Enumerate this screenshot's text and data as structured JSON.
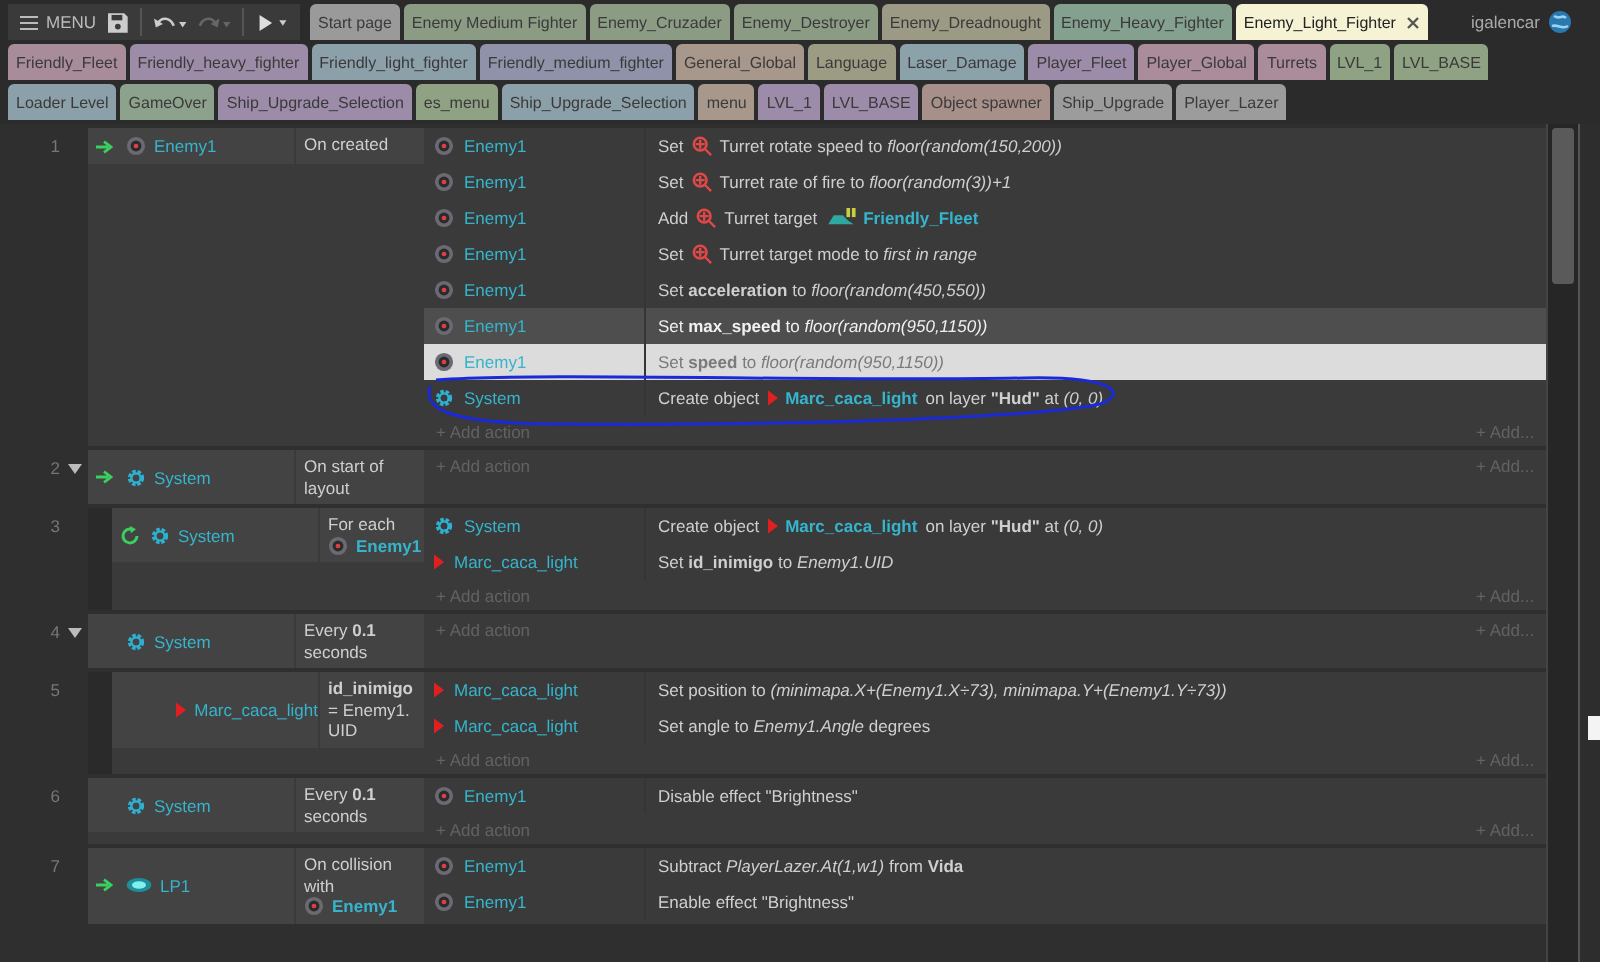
{
  "toolbar": {
    "menu_label": "MENU"
  },
  "tab_rows": [
    [
      {
        "label": "Start page",
        "color": "#9a9a9a",
        "selected": false
      },
      {
        "label": "Enemy Medium Fighter",
        "color": "#8c9c84",
        "selected": false
      },
      {
        "label": "Enemy_Cruzader",
        "color": "#8c9c84",
        "selected": false
      },
      {
        "label": "Enemy_Destroyer",
        "color": "#8c9c84",
        "selected": false
      },
      {
        "label": "Enemy_Dreadnought",
        "color": "#9c9a84",
        "selected": false
      },
      {
        "label": "Enemy_Heavy_Fighter",
        "color": "#84a08e",
        "selected": false
      },
      {
        "label": "Enemy_Light_Fighter",
        "color": "#f6f3d4",
        "selected": true
      }
    ],
    [
      {
        "label": "Friendly_Fleet",
        "color": "#a88c9a",
        "selected": false
      },
      {
        "label": "Friendly_heavy_fighter",
        "color": "#9c8ca8",
        "selected": false
      },
      {
        "label": "Friendly_light_fighter",
        "color": "#8ca0aa",
        "selected": false
      },
      {
        "label": "Friendly_medium_fighter",
        "color": "#9092aa",
        "selected": false
      },
      {
        "label": "General_Global",
        "color": "#a8988c",
        "selected": false
      },
      {
        "label": "Language",
        "color": "#9c9c84",
        "selected": false
      },
      {
        "label": "Laser_Damage",
        "color": "#8ca2aa",
        "selected": false
      },
      {
        "label": "Player_Fleet",
        "color": "#9c8caa",
        "selected": false
      },
      {
        "label": "Player_Global",
        "color": "#aa8c9a",
        "selected": false
      },
      {
        "label": "Turrets",
        "color": "#aa8c9a",
        "selected": false
      },
      {
        "label": "LVL_1",
        "color": "#90a284",
        "selected": false
      },
      {
        "label": "LVL_BASE",
        "color": "#90a284",
        "selected": false
      }
    ],
    [
      {
        "label": "Loader Level",
        "color": "#8ca0aa",
        "selected": false
      },
      {
        "label": "GameOver",
        "color": "#8ca28c",
        "selected": false
      },
      {
        "label": "Ship_Upgrade_Selection",
        "color": "#9c8caa",
        "selected": false
      },
      {
        "label": "es_menu",
        "color": "#90a284",
        "selected": false
      },
      {
        "label": "Ship_Upgrade_Selection",
        "color": "#8ca0aa",
        "selected": false
      },
      {
        "label": "menu",
        "color": "#a8988c",
        "selected": false
      },
      {
        "label": "LVL_1",
        "color": "#9c8caa",
        "selected": false
      },
      {
        "label": "LVL_BASE",
        "color": "#9c8caa",
        "selected": false
      },
      {
        "label": "Object spawner",
        "color": "#a8908a",
        "selected": false
      },
      {
        "label": "Ship_Upgrade",
        "color": "#9c9c9c",
        "selected": false
      },
      {
        "label": "Player_Lazer",
        "color": "#9c9c9c",
        "selected": false
      }
    ]
  ],
  "user": {
    "name": "igalencar"
  },
  "events": [
    {
      "number": "1",
      "condition": {
        "kind": "trigger",
        "object": {
          "kind": "sprite",
          "name": "Enemy1"
        },
        "parts": [
          {
            "kind": "text",
            "text": "On created"
          }
        ]
      },
      "actions": [
        {
          "object": {
            "kind": "sprite",
            "name": "Enemy1"
          },
          "selected": false,
          "hovered": false,
          "parts": [
            {
              "kind": "text",
              "text": "Set"
            },
            {
              "kind": "behavior"
            },
            {
              "kind": "text",
              "text": "Turret rotate speed to *floor(random(150,200))*"
            }
          ]
        },
        {
          "object": {
            "kind": "sprite",
            "name": "Enemy1"
          },
          "selected": false,
          "hovered": false,
          "parts": [
            {
              "kind": "text",
              "text": "Set"
            },
            {
              "kind": "behavior"
            },
            {
              "kind": "text",
              "text": "Turret rate of fire to *floor(random(3))+1*"
            }
          ]
        },
        {
          "object": {
            "kind": "sprite",
            "name": "Enemy1"
          },
          "selected": false,
          "hovered": false,
          "parts": [
            {
              "kind": "text",
              "text": "Add"
            },
            {
              "kind": "behavior"
            },
            {
              "kind": "text",
              "text": "Turret target"
            },
            {
              "kind": "object",
              "object": {
                "kind": "ship",
                "name": "Friendly_Fleet"
              }
            }
          ]
        },
        {
          "object": {
            "kind": "sprite",
            "name": "Enemy1"
          },
          "selected": false,
          "hovered": false,
          "parts": [
            {
              "kind": "text",
              "text": "Set"
            },
            {
              "kind": "behavior"
            },
            {
              "kind": "text",
              "text": "Turret target mode to *first in range*"
            }
          ]
        },
        {
          "object": {
            "kind": "sprite",
            "name": "Enemy1"
          },
          "selected": false,
          "hovered": false,
          "parts": [
            {
              "kind": "text",
              "text": "Set **acceleration** to *floor(random(450,550))*"
            }
          ]
        },
        {
          "object": {
            "kind": "sprite",
            "name": "Enemy1"
          },
          "selected": false,
          "hovered": true,
          "parts": [
            {
              "kind": "text",
              "text": "Set **max_speed** to *floor(random(950,1150))*"
            }
          ]
        },
        {
          "object": {
            "kind": "sprite",
            "name": "Enemy1"
          },
          "selected": true,
          "hovered": false,
          "parts": [
            {
              "kind": "text",
              "text": "Set **speed** to *floor(random(950,1150))*"
            }
          ]
        },
        {
          "object": {
            "kind": "system",
            "name": "System"
          },
          "selected": false,
          "hovered": false,
          "annotated": true,
          "parts": [
            {
              "kind": "text",
              "text": "Create object"
            },
            {
              "kind": "object",
              "object": {
                "kind": "marker",
                "name": "Marc_caca_light"
              }
            },
            {
              "kind": "text",
              "text": "on layer **\"Hud\"** at *(0, 0)*"
            }
          ]
        }
      ],
      "add_action": "+ Add action",
      "add_more": "+ Add..."
    },
    {
      "number": "2",
      "expanded": true,
      "condition": {
        "kind": "trigger",
        "object": {
          "kind": "system",
          "name": "System"
        },
        "parts": [
          {
            "kind": "text",
            "text": "On start of layout"
          }
        ]
      },
      "add_action": "+ Add action",
      "add_more": "+ Add...",
      "children": [
        {
          "number": "3",
          "condition": {
            "kind": "loop",
            "object": {
              "kind": "system",
              "name": "System"
            },
            "parts": [
              {
                "kind": "text",
                "text": "For each"
              },
              {
                "kind": "object",
                "object": {
                  "kind": "sprite",
                  "name": "Enemy1"
                }
              }
            ]
          },
          "actions": [
            {
              "object": {
                "kind": "system",
                "name": "System"
              },
              "selected": false,
              "hovered": false,
              "parts": [
                {
                  "kind": "text",
                  "text": "Create object"
                },
                {
                  "kind": "object",
                  "object": {
                    "kind": "marker",
                    "name": "Marc_caca_light"
                  }
                },
                {
                  "kind": "text",
                  "text": "on layer **\"Hud\"** at *(0, 0)*"
                }
              ]
            },
            {
              "object": {
                "kind": "marker",
                "name": "Marc_caca_light"
              },
              "selected": false,
              "hovered": false,
              "parts": [
                {
                  "kind": "text",
                  "text": "Set **id_inimigo** to *Enemy1.UID*"
                }
              ]
            }
          ],
          "add_action": "+ Add action",
          "add_more": "+ Add..."
        }
      ]
    },
    {
      "number": "4",
      "expanded": true,
      "condition": {
        "kind": "plain",
        "object": {
          "kind": "system",
          "name": "System"
        },
        "parts": [
          {
            "kind": "text",
            "text": "Every **0.1** seconds"
          }
        ]
      },
      "add_action": "+ Add action",
      "add_more": "+ Add...",
      "children": [
        {
          "number": "5",
          "condition": {
            "kind": "plain",
            "object": {
              "kind": "marker",
              "name": "Marc_caca_light"
            },
            "parts": [
              {
                "kind": "text",
                "text": "**id_inimigo** = Enemy1. UID"
              }
            ]
          },
          "actions": [
            {
              "object": {
                "kind": "marker",
                "name": "Marc_caca_light"
              },
              "selected": false,
              "hovered": false,
              "parts": [
                {
                  "kind": "text",
                  "text": "Set position to *(minimapa.X+(Enemy1.X÷73), minimapa.Y+(Enemy1.Y÷73))*"
                }
              ]
            },
            {
              "object": {
                "kind": "marker",
                "name": "Marc_caca_light"
              },
              "selected": false,
              "hovered": false,
              "parts": [
                {
                  "kind": "text",
                  "text": "Set angle to *Enemy1.Angle* degrees"
                }
              ]
            }
          ],
          "add_action": "+ Add action",
          "add_more": "+ Add..."
        }
      ]
    },
    {
      "number": "6",
      "condition": {
        "kind": "plain",
        "object": {
          "kind": "system",
          "name": "System"
        },
        "parts": [
          {
            "kind": "text",
            "text": "Every **0.1** seconds"
          }
        ]
      },
      "actions": [
        {
          "object": {
            "kind": "sprite",
            "name": "Enemy1"
          },
          "selected": false,
          "hovered": false,
          "parts": [
            {
              "kind": "text",
              "text": "Disable effect \"Brightness\""
            }
          ]
        }
      ],
      "add_action": "+ Add action",
      "add_more": "+ Add..."
    },
    {
      "number": "7",
      "condition": {
        "kind": "trigger",
        "object": {
          "kind": "glow",
          "name": "LP1"
        },
        "parts": [
          {
            "kind": "text",
            "text": "On collision with"
          },
          {
            "kind": "object",
            "object": {
              "kind": "sprite",
              "name": "Enemy1"
            }
          }
        ]
      },
      "actions": [
        {
          "object": {
            "kind": "sprite",
            "name": "Enemy1"
          },
          "selected": false,
          "hovered": false,
          "parts": [
            {
              "kind": "text",
              "text": "Subtract *PlayerLazer.At(1,w1)* from **Vida**"
            }
          ]
        },
        {
          "object": {
            "kind": "sprite",
            "name": "Enemy1"
          },
          "selected": false,
          "hovered": false,
          "parts": [
            {
              "kind": "text",
              "text": "Enable effect \"Brightness\""
            }
          ]
        }
      ]
    }
  ]
}
